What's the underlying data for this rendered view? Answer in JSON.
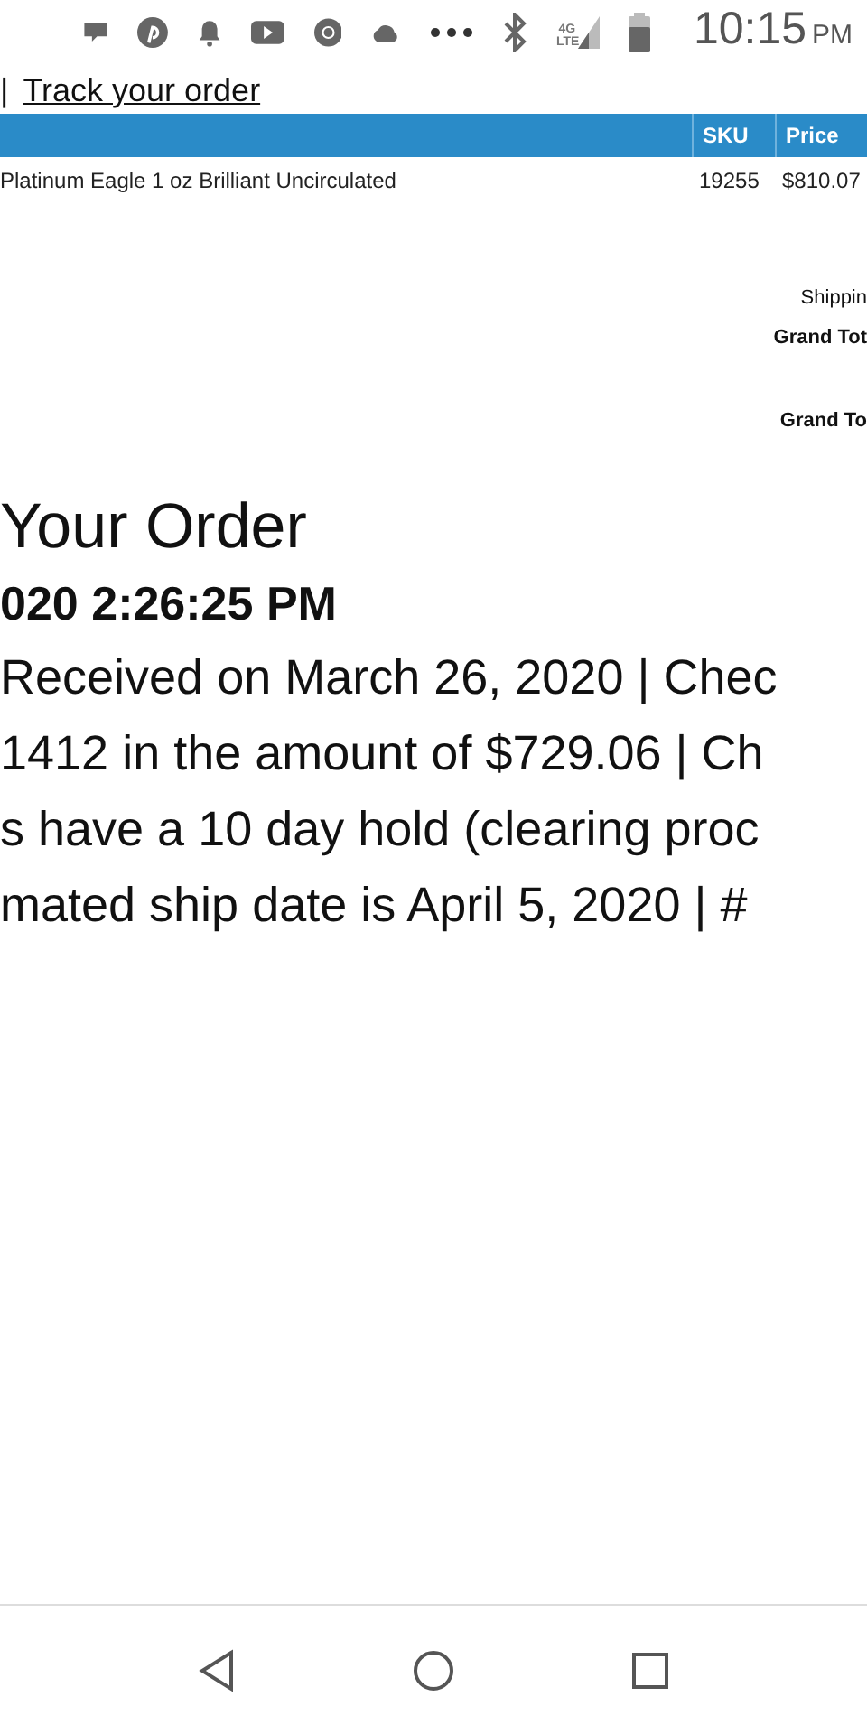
{
  "status_bar": {
    "network": "4G LTE",
    "time": "10:15",
    "meridiem": "PM"
  },
  "track_link": {
    "separator": "|",
    "label": "Track your order"
  },
  "table": {
    "columns": [
      {},
      {
        "label": "SKU"
      },
      {
        "label": "Price"
      }
    ],
    "rows": [
      {
        "item": "Platinum Eagle 1 oz Brilliant Uncirculated",
        "sku": "19255",
        "price": "$810.07"
      }
    ]
  },
  "totals_blocks": [
    {
      "lines": [
        {
          "label": "Shippin",
          "kind": "plain"
        },
        {
          "label": "Grand Tot",
          "kind": "bold"
        }
      ]
    },
    {
      "lines": [
        {
          "label": "Grand To",
          "kind": "bold"
        }
      ]
    }
  ],
  "heading": "Your Order",
  "timestamp": "020 2:26:25 PM",
  "details": [
    "Received on March 26, 2020 | Chec",
    "1412 in the amount of $729.06 | Ch",
    "s have a 10 day hold (clearing proc",
    "mated ship date is April 5, 2020 | #"
  ]
}
